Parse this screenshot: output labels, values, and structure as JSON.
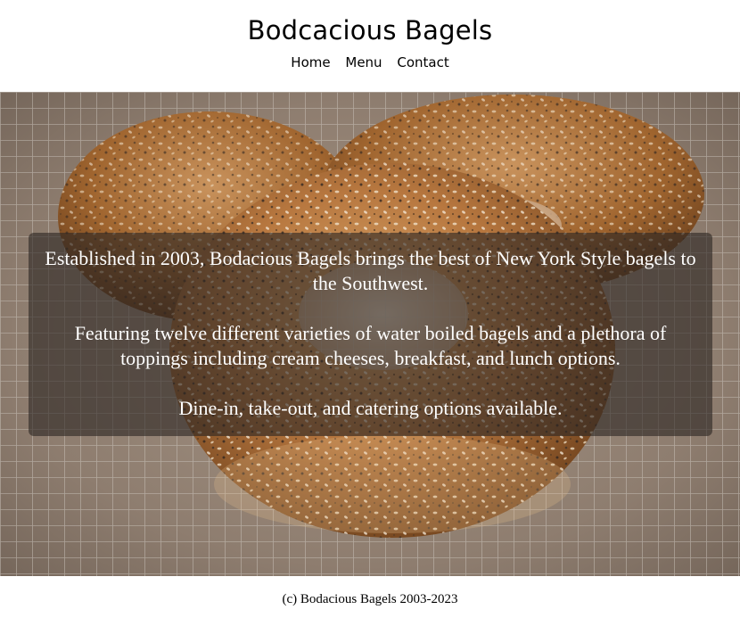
{
  "header": {
    "title": "Bodcacious Bagels",
    "nav": [
      {
        "label": "Home"
      },
      {
        "label": "Menu"
      },
      {
        "label": "Contact"
      }
    ]
  },
  "hero": {
    "image": "bagels-on-cooling-rack",
    "paragraphs": [
      "Established in 2003, Bodacious Bagels brings the best of New York Style bagels to the Southwest.",
      "Featuring twelve different varieties of water boiled bagels and a plethora of toppings including cream cheeses, breakfast, and lunch options.",
      "Dine-in, take-out, and catering options available."
    ]
  },
  "footer": {
    "copyright": "(c) Bodacious Bagels 2003-2023"
  }
}
